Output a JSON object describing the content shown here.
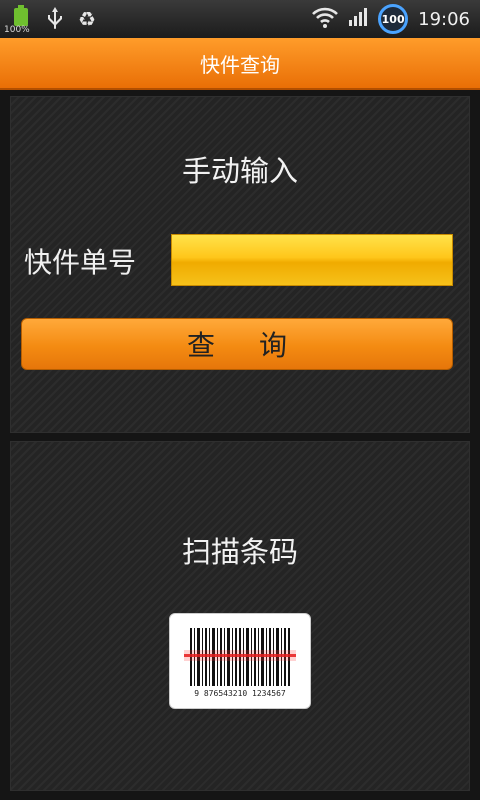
{
  "status_bar": {
    "battery_left_label": "100%",
    "battery_badge": "100",
    "time": "19:06",
    "icons": [
      "battery-icon",
      "usb-icon",
      "recycle-icon",
      "wifi-icon",
      "signal-icon",
      "battery-badge-icon"
    ]
  },
  "title_bar": {
    "title": "快件查询"
  },
  "manual": {
    "heading": "手动输入",
    "field_label": "快件单号",
    "input_value": "",
    "query_button": "查询"
  },
  "scan": {
    "heading": "扫描条码",
    "barcode_text": "9 876543210 1234567"
  },
  "colors": {
    "accent_orange": "#f48b12",
    "input_yellow": "#ffc61a",
    "background": "#151515"
  }
}
